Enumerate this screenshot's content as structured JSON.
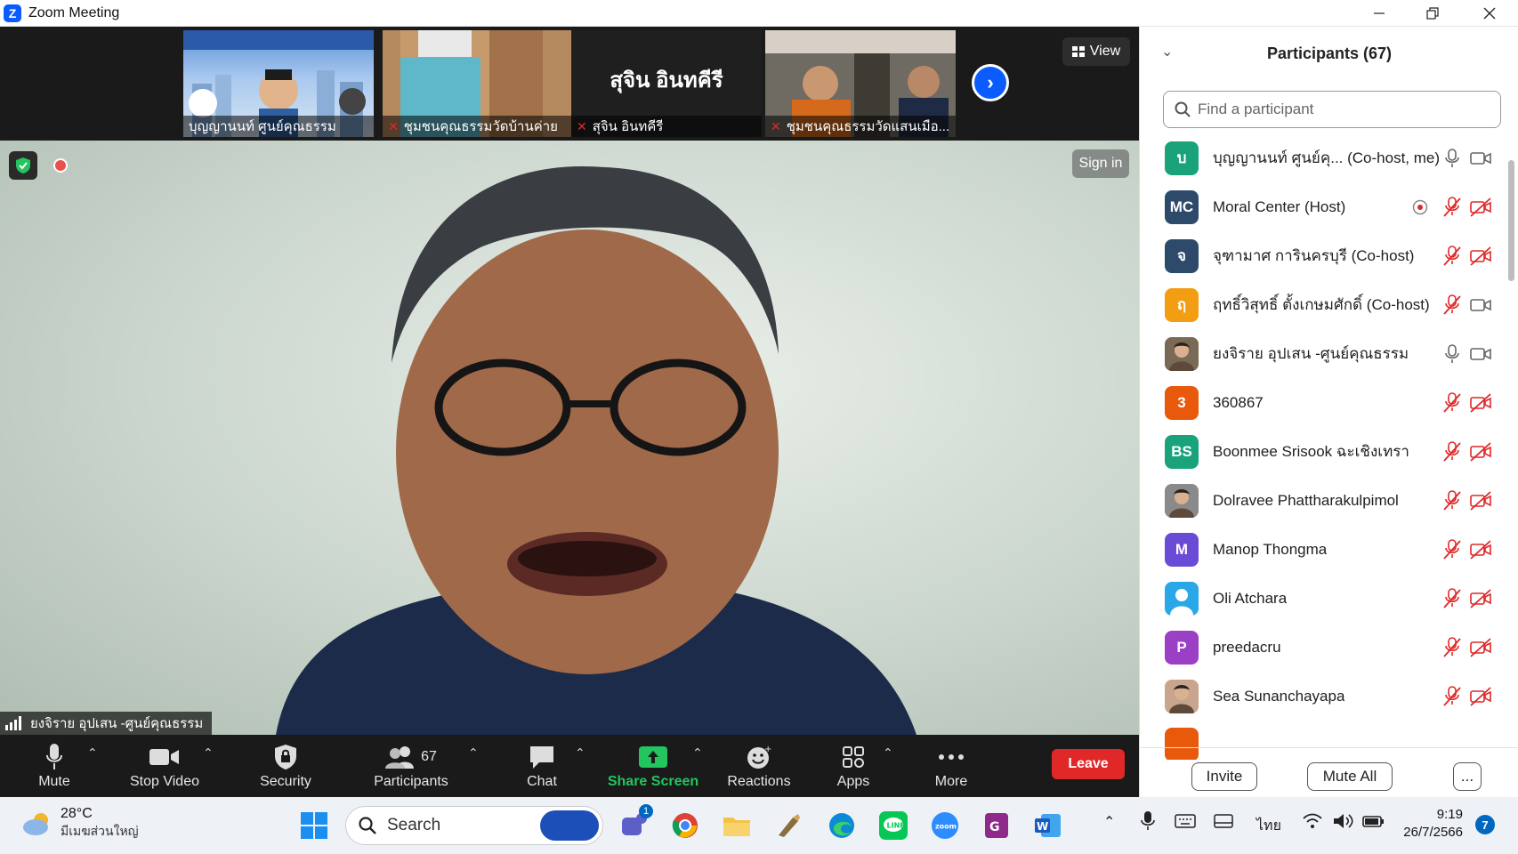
{
  "window": {
    "title": "Zoom Meeting",
    "app_icon": "zoom-logo"
  },
  "gallery": {
    "tiles": [
      {
        "name": "บุญญานนท์ ศูนย์คุณธรรม",
        "muted": false
      },
      {
        "name": "ชุมชนคุณธรรมวัดบ้านค่าย",
        "muted": true
      },
      {
        "name": "สุจิน อินทคีรี",
        "muted": true,
        "center_name": "สุจิน อินทคีรี"
      },
      {
        "name": "ชุมชนคุณธรรมวัดแสนเมือ...",
        "muted": true
      }
    ],
    "view_label": "View"
  },
  "main_video": {
    "sign_in_label": "Sign in",
    "speaker_name": "ยงจิราย อุปเสน -ศูนย์คุณธรรม"
  },
  "toolbar": {
    "mute": "Mute",
    "stop_video": "Stop Video",
    "security": "Security",
    "participants": "Participants",
    "participants_count": "67",
    "chat": "Chat",
    "share_screen": "Share Screen",
    "reactions": "Reactions",
    "apps": "Apps",
    "more": "More",
    "leave": "Leave",
    "share_color": "#22c55e",
    "leave_color": "#e02828"
  },
  "participants_panel": {
    "title": "Participants (67)",
    "search_placeholder": "Find a participant",
    "people": [
      {
        "initials": "บ",
        "color": "#1aa37a",
        "name": "บุญญานนท์ ศูนย์คุ...  (Co-host, me)",
        "mic": "on",
        "video": "on"
      },
      {
        "initials": "MC",
        "color": "#2d4a6b",
        "name": "Moral Center (Host)",
        "mic": "off",
        "video": "off",
        "extra": "record-icon"
      },
      {
        "initials": "จ",
        "color": "#2d4a6b",
        "name": "จุฑามาศ การินครบุรี (Co-host)",
        "mic": "off",
        "video": "off"
      },
      {
        "initials": "ฤ",
        "color": "#f29d12",
        "name": "ฤทธิ์วิสุทธิ์ ตั้งเกษมศักดิ์ (Co-host)",
        "mic": "off",
        "video": "on"
      },
      {
        "initials": "",
        "color": "#7a6a55",
        "name": "ยงจิราย อุปเสน -ศูนย์คุณธรรม",
        "mic": "on",
        "video": "on",
        "photo": true
      },
      {
        "initials": "3",
        "color": "#e8590c",
        "name": "360867",
        "mic": "off",
        "video": "off"
      },
      {
        "initials": "BS",
        "color": "#1aa37a",
        "name": "Boonmee Srisook ฉะเชิงเทรา",
        "mic": "off",
        "video": "off"
      },
      {
        "initials": "",
        "color": "#8a8a8a",
        "name": "Dolravee Phattharakulpimol",
        "mic": "off",
        "video": "off",
        "photo": true
      },
      {
        "initials": "M",
        "color": "#6a4bd6",
        "name": "Manop Thongma",
        "mic": "off",
        "video": "off"
      },
      {
        "initials": "",
        "color": "#2aa7e6",
        "name": "Oli Atchara",
        "mic": "off",
        "video": "off",
        "person": true
      },
      {
        "initials": "P",
        "color": "#9b3fc4",
        "name": "preedacru",
        "mic": "off",
        "video": "off"
      },
      {
        "initials": "",
        "color": "#c9a58d",
        "name": "Sea Sunanchayapa",
        "mic": "off",
        "video": "off",
        "photo": true
      }
    ],
    "invite": "Invite",
    "mute_all": "Mute All",
    "more": "..."
  },
  "taskbar": {
    "temperature": "28°C",
    "weather_desc": "มีเมฆส่วนใหญ่",
    "search": "Search",
    "teams_badge": "1",
    "lang": "ไทย",
    "time": "9:19",
    "date": "26/7/2566",
    "notification_count": "7"
  }
}
